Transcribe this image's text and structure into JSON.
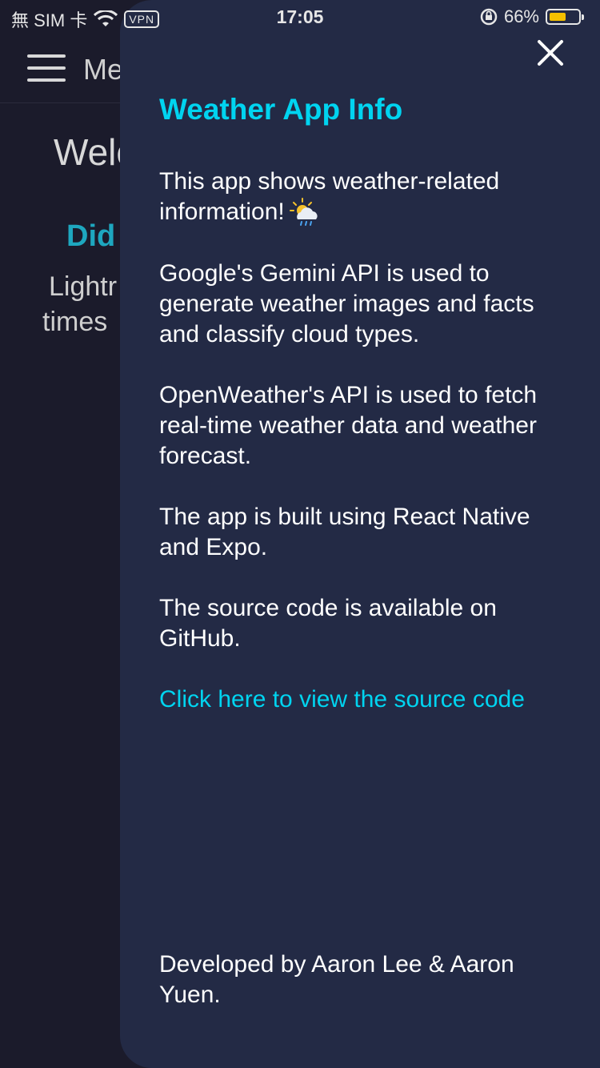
{
  "status_bar": {
    "carrier": "無 SIM 卡",
    "vpn": "VPN",
    "time": "17:05",
    "battery_percent": "66%",
    "battery_level": 0.66
  },
  "background_page": {
    "menu_label": "Me",
    "welcome_text": "Welc",
    "did_text": "Did",
    "fact_line_1": "Lightr",
    "fact_line_2": "times"
  },
  "drawer": {
    "title": "Weather App Info",
    "paragraph_1": "This app shows weather-related information!",
    "paragraph_1_icon": "sun-behind-rain-cloud-icon",
    "paragraph_2": "Google's Gemini API is used to generate weather images and facts and classify cloud types.",
    "paragraph_3": "OpenWeather's API is used to fetch real-time weather data and weather forecast.",
    "paragraph_4": "The app is built using React Native and Expo.",
    "paragraph_5": "The source code is available on GitHub.",
    "source_link": "Click here to view the source code",
    "developer_credit": "Developed by Aaron Lee & Aaron Yuen."
  },
  "colors": {
    "accent": "#00d4f0",
    "drawer_background": "#232a45",
    "page_background": "#1b1b2b",
    "battery_fill": "#f4c000"
  }
}
